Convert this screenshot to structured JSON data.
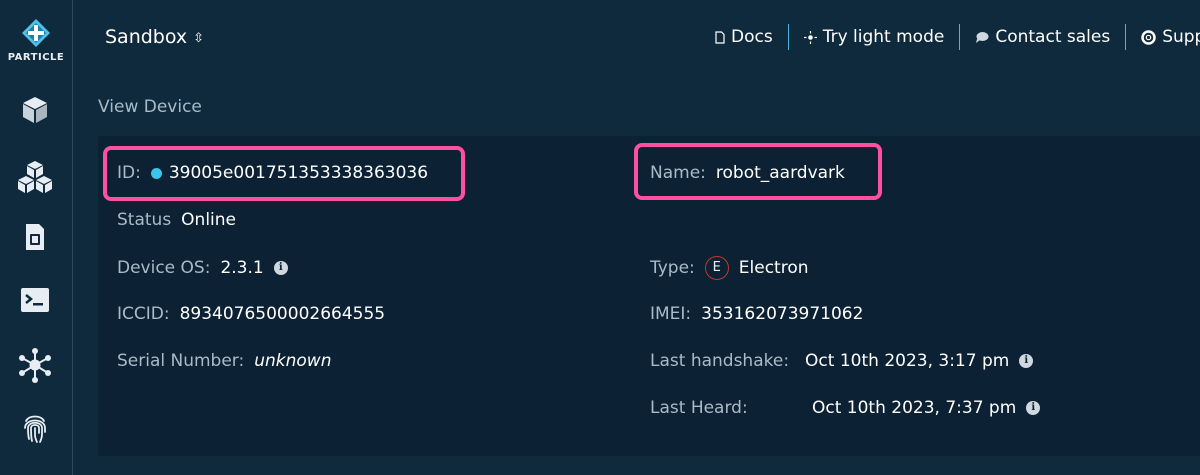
{
  "sidebar": {
    "logo_text": "PARTICLE",
    "items": [
      {
        "icon": "cube-icon"
      },
      {
        "icon": "products-icon"
      },
      {
        "icon": "sim-card-icon"
      },
      {
        "icon": "console-icon"
      },
      {
        "icon": "integrations-icon"
      },
      {
        "icon": "fingerprint-icon"
      }
    ]
  },
  "header": {
    "environment": "Sandbox",
    "nav": [
      {
        "label": "Docs",
        "icon": "document-icon"
      },
      {
        "label": "Try light mode",
        "icon": "sun-icon"
      },
      {
        "label": "Contact sales",
        "icon": "chat-icon"
      },
      {
        "label": "Supp",
        "icon": "lifebuoy-icon"
      }
    ]
  },
  "page": {
    "title": "View Device"
  },
  "device": {
    "id_label": "ID:",
    "id": "39005e001751353338363036",
    "name_label": "Name:",
    "name": "robot_aardvark",
    "status_label": "Status",
    "status": "Online",
    "os_label": "Device OS:",
    "os": "2.3.1",
    "type_label": "Type:",
    "type_badge": "E",
    "type": "Electron",
    "iccid_label": "ICCID:",
    "iccid": "8934076500002664555",
    "imei_label": "IMEI:",
    "imei": "353162073971062",
    "serial_label": "Serial Number:",
    "serial": "unknown",
    "handshake_label": "Last handshake:",
    "handshake": "Oct 10th 2023, 3:17 pm",
    "heard_label": "Last Heard:",
    "heard": "Oct 10th 2023, 7:37 pm",
    "info_glyph": "i"
  },
  "colors": {
    "background": "#0f2a3d",
    "card": "#0c2133",
    "highlight": "#ff4fa3",
    "online_dot": "#38c6ec",
    "separator": "#4fb3d9"
  }
}
